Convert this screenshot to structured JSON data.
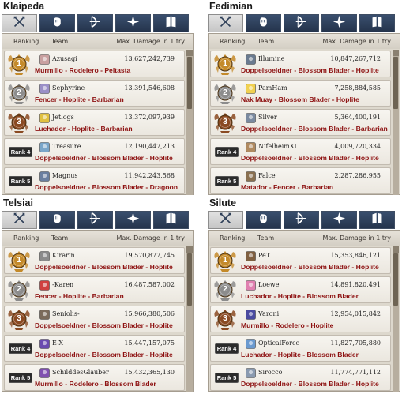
{
  "headers": {
    "ranking": "Ranking",
    "team": "Team",
    "damage": "Max. Damage in 1 try"
  },
  "colors": {
    "tab_dark": "#2e3f58",
    "tab_active": "#d6d6d6",
    "class_text": "#8e1212",
    "medal_gold": "#c48a2a",
    "medal_silver": "#8c8c8c",
    "medal_bronze": "#8a4a22"
  },
  "tab_icons": [
    "crossed-swords-icon",
    "fist-icon",
    "bow-icon",
    "cross-star-icon",
    "book-icon"
  ],
  "quads": [
    {
      "server": "Klaipeda",
      "rows": [
        {
          "rank": "1",
          "team": "Azusagi",
          "damage": "13,627,242,739",
          "classes": "Murmillo - Rodelero - Peltasta",
          "avatar": "#c9a0a0"
        },
        {
          "rank": "2",
          "team": "Sephyrine",
          "damage": "13,391,546,608",
          "classes": "Fencer - Hoplite - Barbarian",
          "avatar": "#9a8fc7"
        },
        {
          "rank": "3",
          "team": "Jetlogs",
          "damage": "13,372,097,939",
          "classes": "Luchador - Hoplite - Barbarian",
          "avatar": "#e0c040"
        },
        {
          "rank": "Rank 4",
          "team": "Treasure",
          "damage": "12,190,447,213",
          "classes": "Doppelsoeldner - Blossom Blader - Hoplite",
          "avatar": "#7aa6c9"
        },
        {
          "rank": "Rank 5",
          "team": "Magnus",
          "damage": "11,942,243,568",
          "classes": "Doppelsoeldner - Blossom Blader - Dragoon",
          "avatar": "#6a7fa0"
        }
      ]
    },
    {
      "server": "Fedimian",
      "rows": [
        {
          "rank": "1",
          "team": "Illumine",
          "damage": "10,847,267,712",
          "classes": "Doppelsoeldner - Blossom Blader - Hoplite",
          "avatar": "#6a7a8f"
        },
        {
          "rank": "2",
          "team": "PamHam",
          "damage": "7,258,884,585",
          "classes": "Nak Muay - Blossom Blader - Hoplite",
          "avatar": "#f0d050"
        },
        {
          "rank": "3",
          "team": "Silver",
          "damage": "5,364,400,191",
          "classes": "Doppelsoeldner - Blossom Blader - Barbarian",
          "avatar": "#7a8aa0"
        },
        {
          "rank": "Rank 4",
          "team": "NifelheimXI",
          "damage": "4,009,720,334",
          "classes": "Doppelsoeldner - Blossom Blader - Hoplite",
          "avatar": "#b08a60"
        },
        {
          "rank": "Rank 5",
          "team": "Falce",
          "damage": "2,287,286,955",
          "classes": "Matador - Fencer - Barbarian",
          "avatar": "#8a7050"
        }
      ]
    },
    {
      "server": "Telsiai",
      "rows": [
        {
          "rank": "1",
          "team": "Kirarin",
          "damage": "19,570,877,745",
          "classes": "Doppelsoeldner - Blossom Blader - Hoplite",
          "avatar": "#8a8a8a"
        },
        {
          "rank": "2",
          "team": "-Karen",
          "damage": "16,487,587,002",
          "classes": "Fencer - Hoplite - Barbarian",
          "avatar": "#d04040"
        },
        {
          "rank": "3",
          "team": "Seniolis-",
          "damage": "15,966,380,506",
          "classes": "Doppelsoeldner - Blossom Blader - Hoplite",
          "avatar": "#7a6a5a"
        },
        {
          "rank": "Rank 4",
          "team": "E-X",
          "damage": "15,447,157,075",
          "classes": "Doppelsoeldner - Blossom Blader - Hoplite",
          "avatar": "#6a4ab0"
        },
        {
          "rank": "Rank 5",
          "team": "SchilddesGlauber",
          "damage": "15,432,365,130",
          "classes": "Murmillo - Rodelero - Blossom Blader",
          "avatar": "#8050b0"
        }
      ]
    },
    {
      "server": "Silute",
      "rows": [
        {
          "rank": "1",
          "team": "PeT",
          "damage": "15,353,846,121",
          "classes": "Doppelsoeldner - Blossom Blader - Hoplite",
          "avatar": "#806040"
        },
        {
          "rank": "2",
          "team": "Loewe",
          "damage": "14,891,820,491",
          "classes": "Luchador - Hoplite - Blossom Blader",
          "avatar": "#e080b0"
        },
        {
          "rank": "3",
          "team": "Varoni",
          "damage": "12,954,015,842",
          "classes": "Murmillo - Rodelero - Hoplite",
          "avatar": "#4a4aa0"
        },
        {
          "rank": "Rank 4",
          "team": "OpticalForce",
          "damage": "11,827,705,880",
          "classes": "Luchador - Hoplite - Blossom Blader",
          "avatar": "#6a9ad0"
        },
        {
          "rank": "Rank 5",
          "team": "Sirocco",
          "damage": "11,774,771,112",
          "classes": "Doppelsoeldner - Blossom Blader - Hoplite",
          "avatar": "#8a9ab0"
        }
      ]
    }
  ]
}
